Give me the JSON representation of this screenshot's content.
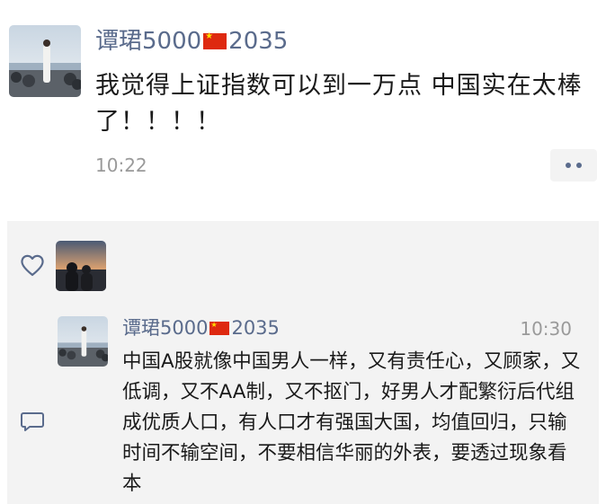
{
  "post": {
    "username": "谭珺5000",
    "username_suffix": "2035",
    "text": "我觉得上证指数可以到一万点 中国实在太棒了！！！！",
    "time": "10:22",
    "avatar_icon": "person-on-beach-photo",
    "more_icon": "two-dot-more-icon"
  },
  "interaction": {
    "like_icon": "heart-outline-icon",
    "liker_avatar_icon": "couple-at-sunset-photo",
    "comment_icon": "comment-bubble-icon",
    "comment": {
      "username": "谭珺5000",
      "username_suffix": "2035",
      "time": "10:30",
      "text": "中国A股就像中国男人一样，又有责任心，又顾家，又低调，又不AA制，又不抠门，好男人才配繁衍后代组成优质人口，有人口才有强国大国，均值回归，只输时间不输空间，不要相信华丽的外表，要透过现象看本"
    }
  },
  "colors": {
    "name_link": "#5a6b8c",
    "timestamp": "#9a9a9a",
    "interaction_bg": "#f3f3f3",
    "flag_red": "#de2910",
    "flag_star": "#ffde00"
  }
}
